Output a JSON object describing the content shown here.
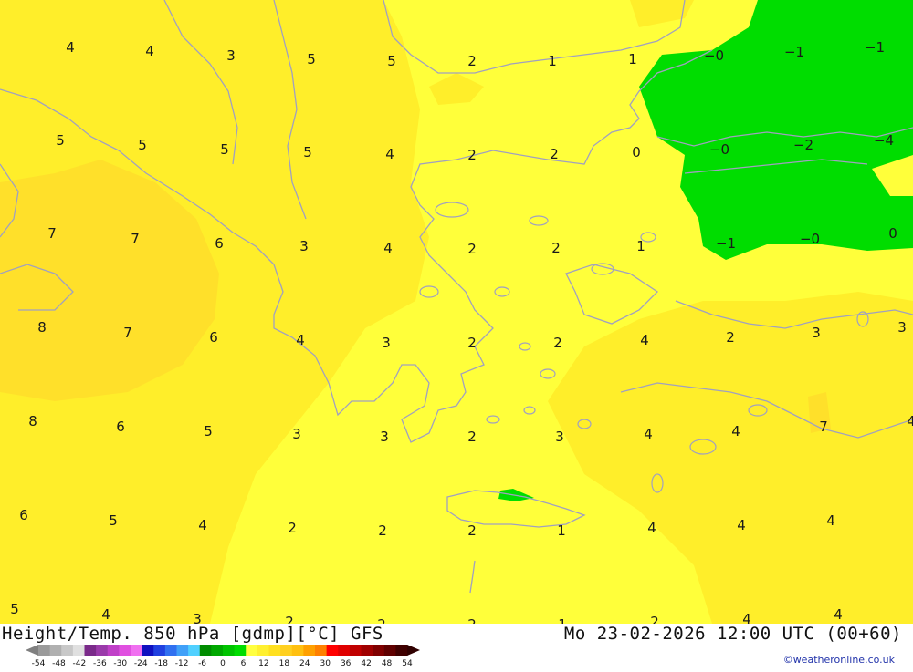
{
  "header": {
    "title": "Height/Temp. 850 hPa [gdmp][°C] GFS",
    "valid_time": "Mo 23-02-2026 12:00 UTC (00+60)"
  },
  "credit": "©weatheronline.co.uk",
  "colors": {
    "yellow_light": "#ffff3a",
    "yellow_mid": "#ffee2a",
    "yellow_dark": "#ffe02a",
    "green": "#00dd00",
    "coastline": "#a0a0c0"
  },
  "grid_values": [
    "4",
    "4",
    "3",
    "5",
    "5",
    "2",
    "1",
    "1",
    "-0",
    "-1",
    "-1",
    "5",
    "5",
    "5",
    "5",
    "4",
    "2",
    "2",
    "0",
    "-0",
    "-2",
    "-4",
    "7",
    "7",
    "6",
    "3",
    "4",
    "2",
    "2",
    "1",
    "-1",
    "-0",
    "0",
    "8",
    "7",
    "6",
    "4",
    "3",
    "2",
    "2",
    "4",
    "2",
    "3",
    "3",
    "8",
    "6",
    "5",
    "3",
    "3",
    "2",
    "3",
    "4",
    "4",
    "7",
    "4",
    "6",
    "5",
    "4",
    "2",
    "2",
    "2",
    "1",
    "4",
    "4",
    "4",
    "5",
    "4",
    "3",
    "2",
    "2",
    "2",
    "1",
    "2",
    "4",
    "4"
  ],
  "legend": {
    "ticks": [
      "-54",
      "-48",
      "-42",
      "-36",
      "-30",
      "-24",
      "-18",
      "-12",
      "-6",
      "0",
      "6",
      "12",
      "18",
      "24",
      "30",
      "36",
      "42",
      "48",
      "54"
    ],
    "colors": [
      "#9a9a9a",
      "#b0b0b0",
      "#c8c8c8",
      "#e0e0e0",
      "#7a2a8a",
      "#9a3aaa",
      "#c040c8",
      "#e050e0",
      "#f070f0",
      "#1010c0",
      "#2040e0",
      "#3070f0",
      "#40a0f8",
      "#50d0ff",
      "#008c00",
      "#00a800",
      "#00c400",
      "#00dd00",
      "#ffff40",
      "#fff030",
      "#ffe020",
      "#ffd020",
      "#ffc010",
      "#ffa000",
      "#ff8000",
      "#ff0000",
      "#e00000",
      "#c00000",
      "#a00000",
      "#800000",
      "#600000",
      "#400000"
    ]
  }
}
